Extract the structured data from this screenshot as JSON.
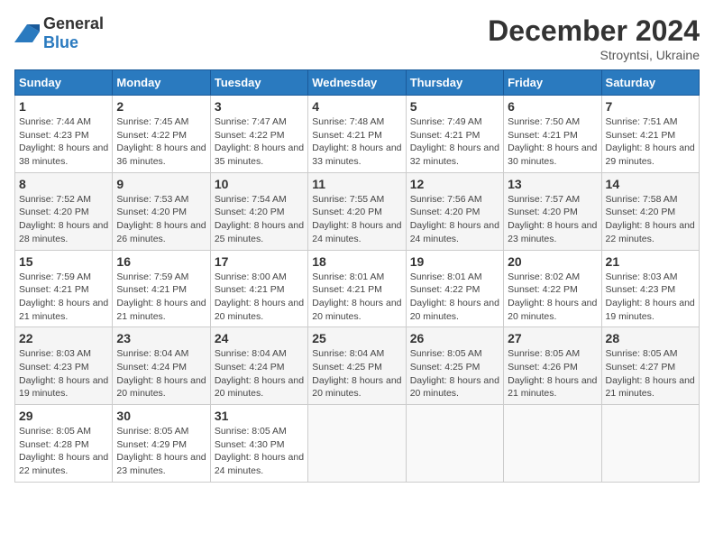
{
  "header": {
    "logo": {
      "general": "General",
      "blue": "Blue"
    },
    "title": "December 2024",
    "subtitle": "Stroyntsi, Ukraine"
  },
  "calendar": {
    "weekdays": [
      "Sunday",
      "Monday",
      "Tuesday",
      "Wednesday",
      "Thursday",
      "Friday",
      "Saturday"
    ],
    "weeks": [
      [
        {
          "day": "1",
          "sunrise": "7:44 AM",
          "sunset": "4:23 PM",
          "daylight": "8 hours and 38 minutes."
        },
        {
          "day": "2",
          "sunrise": "7:45 AM",
          "sunset": "4:22 PM",
          "daylight": "8 hours and 36 minutes."
        },
        {
          "day": "3",
          "sunrise": "7:47 AM",
          "sunset": "4:22 PM",
          "daylight": "8 hours and 35 minutes."
        },
        {
          "day": "4",
          "sunrise": "7:48 AM",
          "sunset": "4:21 PM",
          "daylight": "8 hours and 33 minutes."
        },
        {
          "day": "5",
          "sunrise": "7:49 AM",
          "sunset": "4:21 PM",
          "daylight": "8 hours and 32 minutes."
        },
        {
          "day": "6",
          "sunrise": "7:50 AM",
          "sunset": "4:21 PM",
          "daylight": "8 hours and 30 minutes."
        },
        {
          "day": "7",
          "sunrise": "7:51 AM",
          "sunset": "4:21 PM",
          "daylight": "8 hours and 29 minutes."
        }
      ],
      [
        {
          "day": "8",
          "sunrise": "7:52 AM",
          "sunset": "4:20 PM",
          "daylight": "8 hours and 28 minutes."
        },
        {
          "day": "9",
          "sunrise": "7:53 AM",
          "sunset": "4:20 PM",
          "daylight": "8 hours and 26 minutes."
        },
        {
          "day": "10",
          "sunrise": "7:54 AM",
          "sunset": "4:20 PM",
          "daylight": "8 hours and 25 minutes."
        },
        {
          "day": "11",
          "sunrise": "7:55 AM",
          "sunset": "4:20 PM",
          "daylight": "8 hours and 24 minutes."
        },
        {
          "day": "12",
          "sunrise": "7:56 AM",
          "sunset": "4:20 PM",
          "daylight": "8 hours and 24 minutes."
        },
        {
          "day": "13",
          "sunrise": "7:57 AM",
          "sunset": "4:20 PM",
          "daylight": "8 hours and 23 minutes."
        },
        {
          "day": "14",
          "sunrise": "7:58 AM",
          "sunset": "4:20 PM",
          "daylight": "8 hours and 22 minutes."
        }
      ],
      [
        {
          "day": "15",
          "sunrise": "7:59 AM",
          "sunset": "4:21 PM",
          "daylight": "8 hours and 21 minutes."
        },
        {
          "day": "16",
          "sunrise": "7:59 AM",
          "sunset": "4:21 PM",
          "daylight": "8 hours and 21 minutes."
        },
        {
          "day": "17",
          "sunrise": "8:00 AM",
          "sunset": "4:21 PM",
          "daylight": "8 hours and 20 minutes."
        },
        {
          "day": "18",
          "sunrise": "8:01 AM",
          "sunset": "4:21 PM",
          "daylight": "8 hours and 20 minutes."
        },
        {
          "day": "19",
          "sunrise": "8:01 AM",
          "sunset": "4:22 PM",
          "daylight": "8 hours and 20 minutes."
        },
        {
          "day": "20",
          "sunrise": "8:02 AM",
          "sunset": "4:22 PM",
          "daylight": "8 hours and 20 minutes."
        },
        {
          "day": "21",
          "sunrise": "8:03 AM",
          "sunset": "4:23 PM",
          "daylight": "8 hours and 19 minutes."
        }
      ],
      [
        {
          "day": "22",
          "sunrise": "8:03 AM",
          "sunset": "4:23 PM",
          "daylight": "8 hours and 19 minutes."
        },
        {
          "day": "23",
          "sunrise": "8:04 AM",
          "sunset": "4:24 PM",
          "daylight": "8 hours and 20 minutes."
        },
        {
          "day": "24",
          "sunrise": "8:04 AM",
          "sunset": "4:24 PM",
          "daylight": "8 hours and 20 minutes."
        },
        {
          "day": "25",
          "sunrise": "8:04 AM",
          "sunset": "4:25 PM",
          "daylight": "8 hours and 20 minutes."
        },
        {
          "day": "26",
          "sunrise": "8:05 AM",
          "sunset": "4:25 PM",
          "daylight": "8 hours and 20 minutes."
        },
        {
          "day": "27",
          "sunrise": "8:05 AM",
          "sunset": "4:26 PM",
          "daylight": "8 hours and 21 minutes."
        },
        {
          "day": "28",
          "sunrise": "8:05 AM",
          "sunset": "4:27 PM",
          "daylight": "8 hours and 21 minutes."
        }
      ],
      [
        {
          "day": "29",
          "sunrise": "8:05 AM",
          "sunset": "4:28 PM",
          "daylight": "8 hours and 22 minutes."
        },
        {
          "day": "30",
          "sunrise": "8:05 AM",
          "sunset": "4:29 PM",
          "daylight": "8 hours and 23 minutes."
        },
        {
          "day": "31",
          "sunrise": "8:05 AM",
          "sunset": "4:30 PM",
          "daylight": "8 hours and 24 minutes."
        },
        null,
        null,
        null,
        null
      ]
    ]
  }
}
